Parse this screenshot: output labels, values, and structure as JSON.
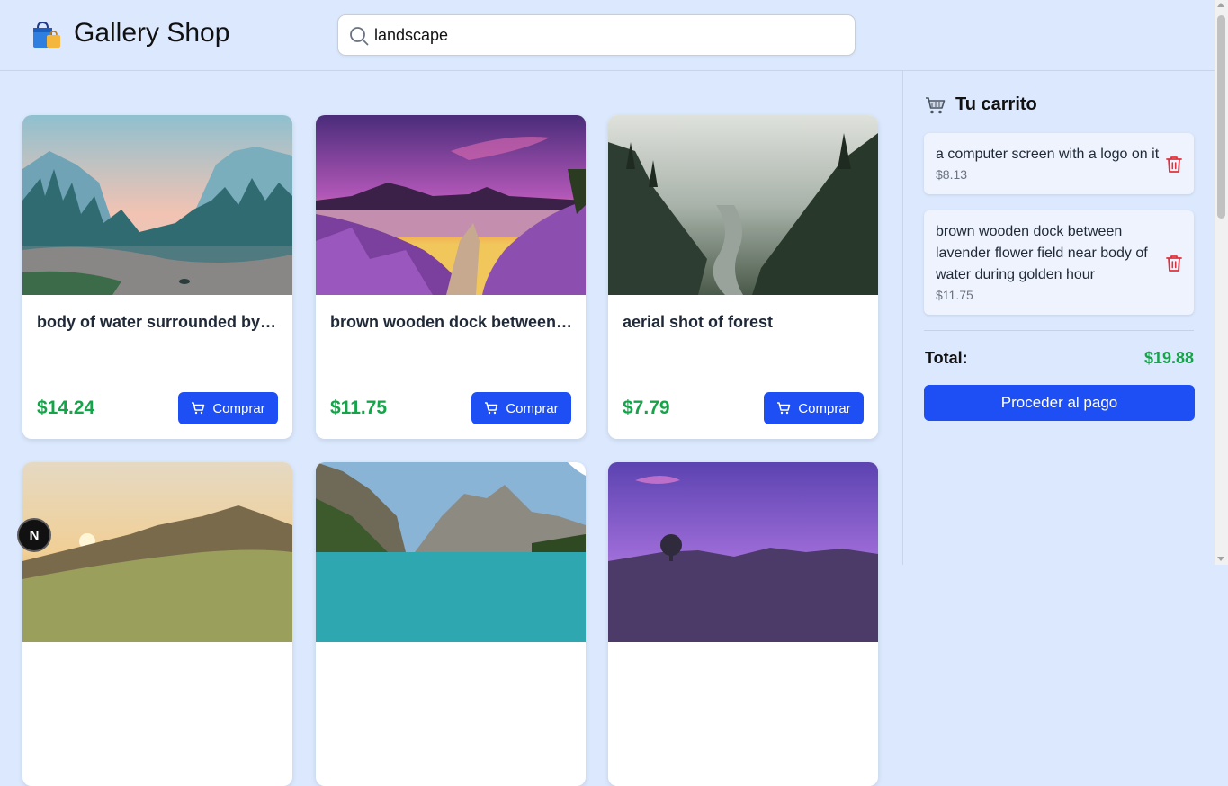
{
  "header": {
    "brand": "Gallery Shop",
    "logo_icon": "shopping-bags-icon",
    "search": {
      "value": "landscape",
      "icon": "search-icon"
    }
  },
  "products": [
    {
      "title": "body of water surrounded by trees",
      "price": "$14.24",
      "buy_label": "Comprar"
    },
    {
      "title": "brown wooden dock between lavender flower field near body of water during golden hour",
      "price": "$11.75",
      "buy_label": "Comprar"
    },
    {
      "title": "aerial shot of forest",
      "price": "$7.79",
      "buy_label": "Comprar"
    }
  ],
  "cart": {
    "title": "Tu carrito",
    "icon": "shopping-cart-icon",
    "items": [
      {
        "title": "a computer screen with a logo on it",
        "price": "$8.13"
      },
      {
        "title": "brown wooden dock between lavender flower field near body of water during golden hour",
        "price": "$11.75"
      }
    ],
    "total_label": "Total:",
    "total_value": "$19.88",
    "checkout_label": "Proceder al pago"
  },
  "dev_badge": {
    "label": "N"
  },
  "colors": {
    "accent": "#1d4ff5",
    "price": "#16a34a",
    "background": "#dbe8fd",
    "delete": "#e0323c"
  }
}
